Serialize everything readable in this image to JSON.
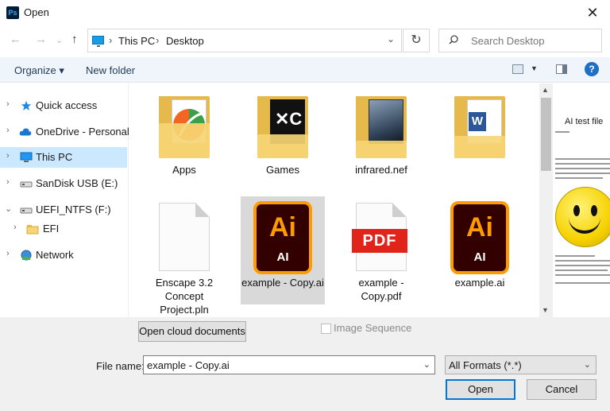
{
  "window": {
    "title": "Open",
    "app_icon": "ps-icon",
    "close": "✕"
  },
  "nav": {
    "back": "←",
    "forward": "→",
    "recent": "⌄",
    "up": "↑",
    "breadcrumbs": [
      "This PC",
      "Desktop"
    ],
    "refresh": "↻",
    "search_placeholder": "Search Desktop"
  },
  "toolbar": {
    "organize": "Organize ▾",
    "new_folder": "New folder",
    "help": "?"
  },
  "sidebar": {
    "items": [
      {
        "label": "Quick access",
        "icon": "star-icon"
      },
      {
        "label": "OneDrive - Personal",
        "icon": "cloud-icon"
      },
      {
        "label": "This PC",
        "icon": "pc-icon",
        "selected": true
      },
      {
        "label": "SanDisk USB (E:)",
        "icon": "drive-icon"
      },
      {
        "label": "UEFI_NTFS (F:)",
        "icon": "drive-icon",
        "expanded": true
      },
      {
        "label": "EFI",
        "icon": "folder-icon"
      },
      {
        "label": "Network",
        "icon": "network-icon"
      }
    ]
  },
  "files": [
    {
      "name": "Apps",
      "type": "folder"
    },
    {
      "name": "Games",
      "type": "folder"
    },
    {
      "name": "infrared.nef",
      "type": "folder"
    },
    {
      "name": "",
      "type": "folder"
    },
    {
      "name": "Enscape 3.2 Concept Project.pln",
      "type": "document"
    },
    {
      "name": "example - Copy.ai",
      "type": "illustrator",
      "selected": true
    },
    {
      "name": "example - Copy.pdf",
      "type": "pdf"
    },
    {
      "name": "example.ai",
      "type": "illustrator"
    }
  ],
  "icon_text": {
    "ai_big": "Ai",
    "ai_small": "AI",
    "pdf": "PDF"
  },
  "preview": {
    "title": "AI test file"
  },
  "bottom": {
    "cloud_button": "Open cloud documents",
    "image_sequence": "Image Sequence",
    "file_name_label": "File name:",
    "file_name_value": "example - Copy.ai",
    "format_value": "All Formats (*.*)",
    "open_button": "Open",
    "cancel_button": "Cancel"
  },
  "colors": {
    "accent": "#0078d7",
    "selection": "#cce8ff",
    "ai_orange": "#ff9a00",
    "pdf_red": "#e2231a"
  }
}
